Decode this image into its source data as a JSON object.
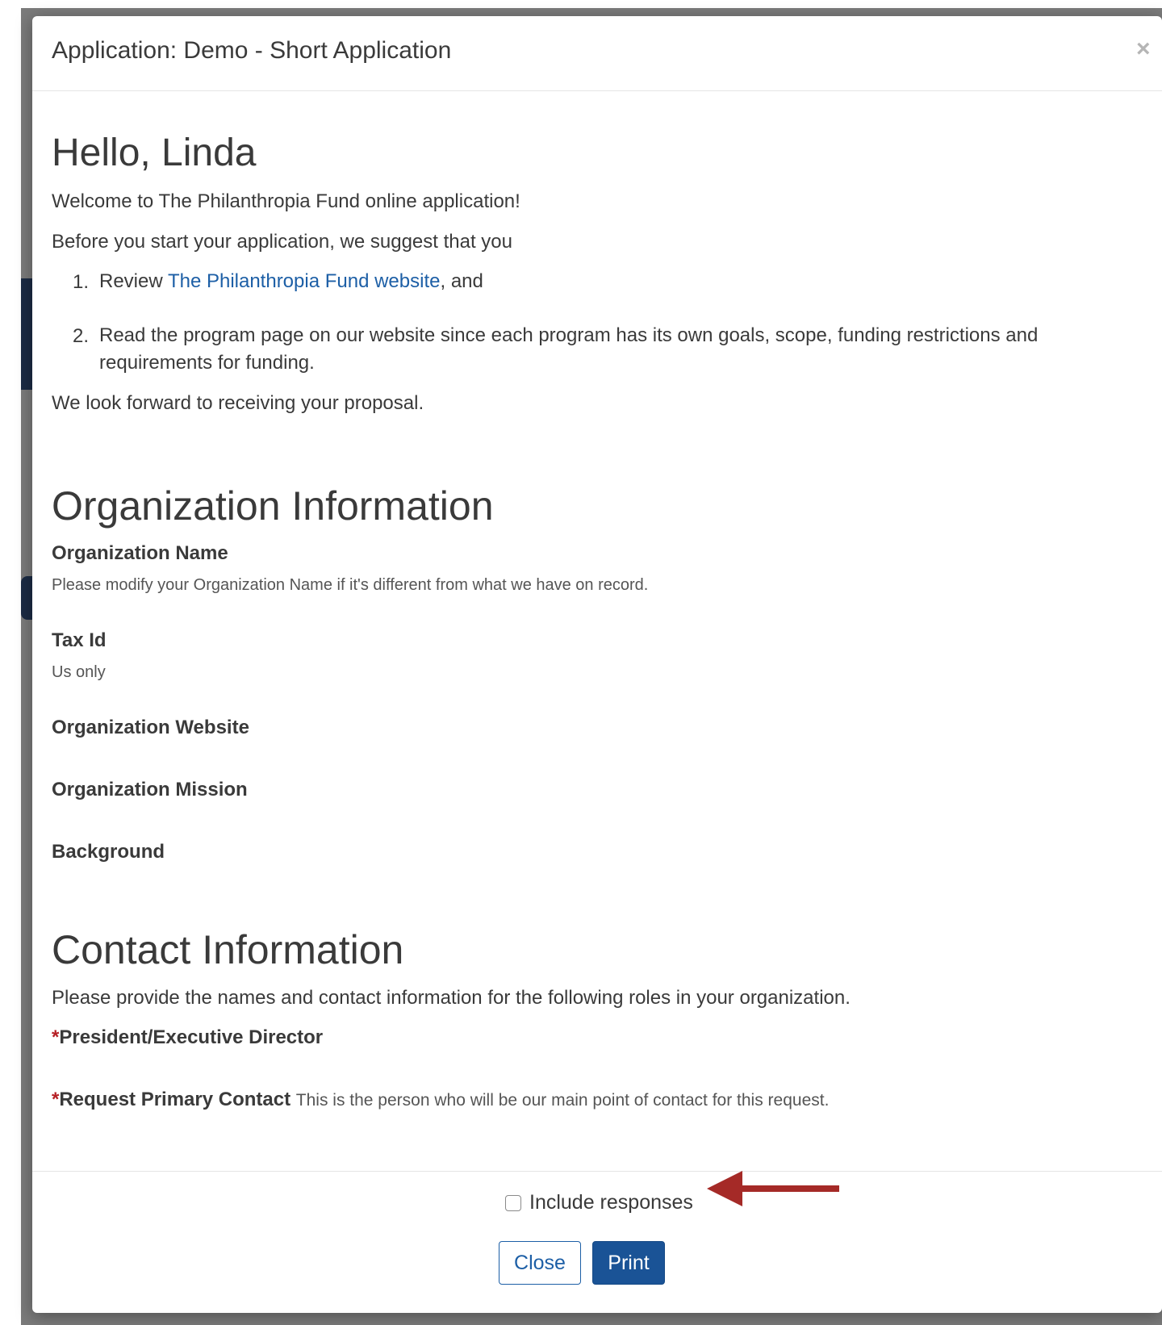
{
  "modal": {
    "title": "Application: Demo - Short Application",
    "close_glyph": "×"
  },
  "intro": {
    "greeting": "Hello, Linda",
    "welcome": "Welcome to The Philanthropia Fund online application!",
    "suggest": "Before you start your application, we suggest that you",
    "steps": [
      {
        "number": "1.",
        "prefix": "Review ",
        "link_text": "The Philanthropia Fund website",
        "suffix": ", and"
      },
      {
        "number": "2.",
        "text": "Read the program page on our website since each program has its own goals, scope, funding restrictions and requirements for funding."
      }
    ],
    "closing": "We look forward to receiving your proposal."
  },
  "organization": {
    "heading": "Organization Information",
    "fields": [
      {
        "label": "Organization Name",
        "help": "Please modify your Organization Name if it's different from what we have on record."
      },
      {
        "label": "Tax Id",
        "help": "Us only"
      },
      {
        "label": "Organization Website"
      },
      {
        "label": "Organization Mission"
      },
      {
        "label": "Background"
      }
    ]
  },
  "contact": {
    "heading": "Contact Information",
    "intro": "Please provide the names and contact information for the following roles in your organization.",
    "required_mark": "*",
    "fields": [
      {
        "label": "President/Executive Director"
      },
      {
        "label": "Request Primary Contact",
        "help": "This is the person who will be our main point of contact for this request."
      }
    ]
  },
  "footer": {
    "include_responses_label": "Include responses",
    "include_responses_checked": false,
    "close_label": "Close",
    "print_label": "Print"
  },
  "colors": {
    "link": "#1d5fa6",
    "primary_button": "#1a5396",
    "required": "#b51e23",
    "arrow": "#a52a27"
  }
}
